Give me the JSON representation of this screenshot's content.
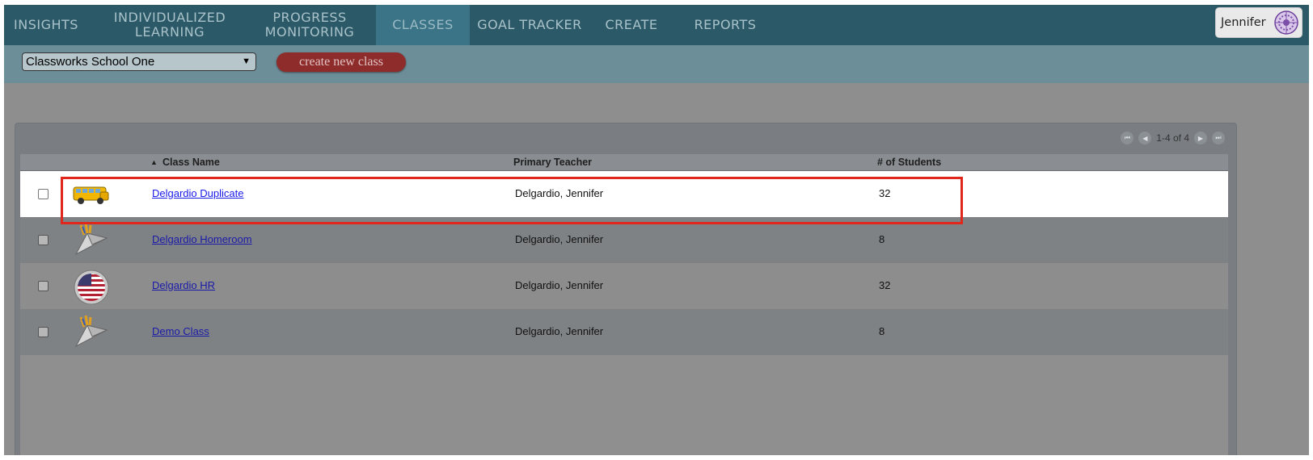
{
  "nav": {
    "items": [
      {
        "label": "INSIGHTS"
      },
      {
        "label": "INDIVIDUALIZED LEARNING"
      },
      {
        "label": "PROGRESS MONITORING"
      },
      {
        "label": "CLASSES"
      },
      {
        "label": "GOAL TRACKER"
      },
      {
        "label": "CREATE"
      },
      {
        "label": "REPORTS"
      }
    ],
    "active": "CLASSES",
    "user_name": "Jennifer"
  },
  "toolbar": {
    "school_select_value": "Classworks School One",
    "create_button_label": "create new class"
  },
  "pager": {
    "text": "1-4 of 4"
  },
  "table": {
    "headers": {
      "class_name": "Class Name",
      "sort_indicator": "▲",
      "primary_teacher": "Primary Teacher",
      "students": "# of Students"
    },
    "rows": [
      {
        "class_name": "Delgardio Duplicate",
        "teacher": "Delgardio, Jennifer",
        "students": "32",
        "icon": "school-bus-icon",
        "selected": true
      },
      {
        "class_name": "Delgardio Homeroom",
        "teacher": "Delgardio, Jennifer",
        "students": "8",
        "icon": "paper-plane-icon",
        "selected": false
      },
      {
        "class_name": "Delgardio HR",
        "teacher": "Delgardio, Jennifer",
        "students": "32",
        "icon": "us-flag-icon",
        "selected": false
      },
      {
        "class_name": "Demo Class",
        "teacher": "Delgardio, Jennifer",
        "students": "8",
        "icon": "paper-plane-icon",
        "selected": false
      }
    ]
  },
  "colors": {
    "nav_bg": "#2c5968",
    "nav_active_bg": "#3a7486",
    "create_button": "#8e2c2c",
    "highlight_border": "#e1261c",
    "link": "#1a1ae8"
  }
}
